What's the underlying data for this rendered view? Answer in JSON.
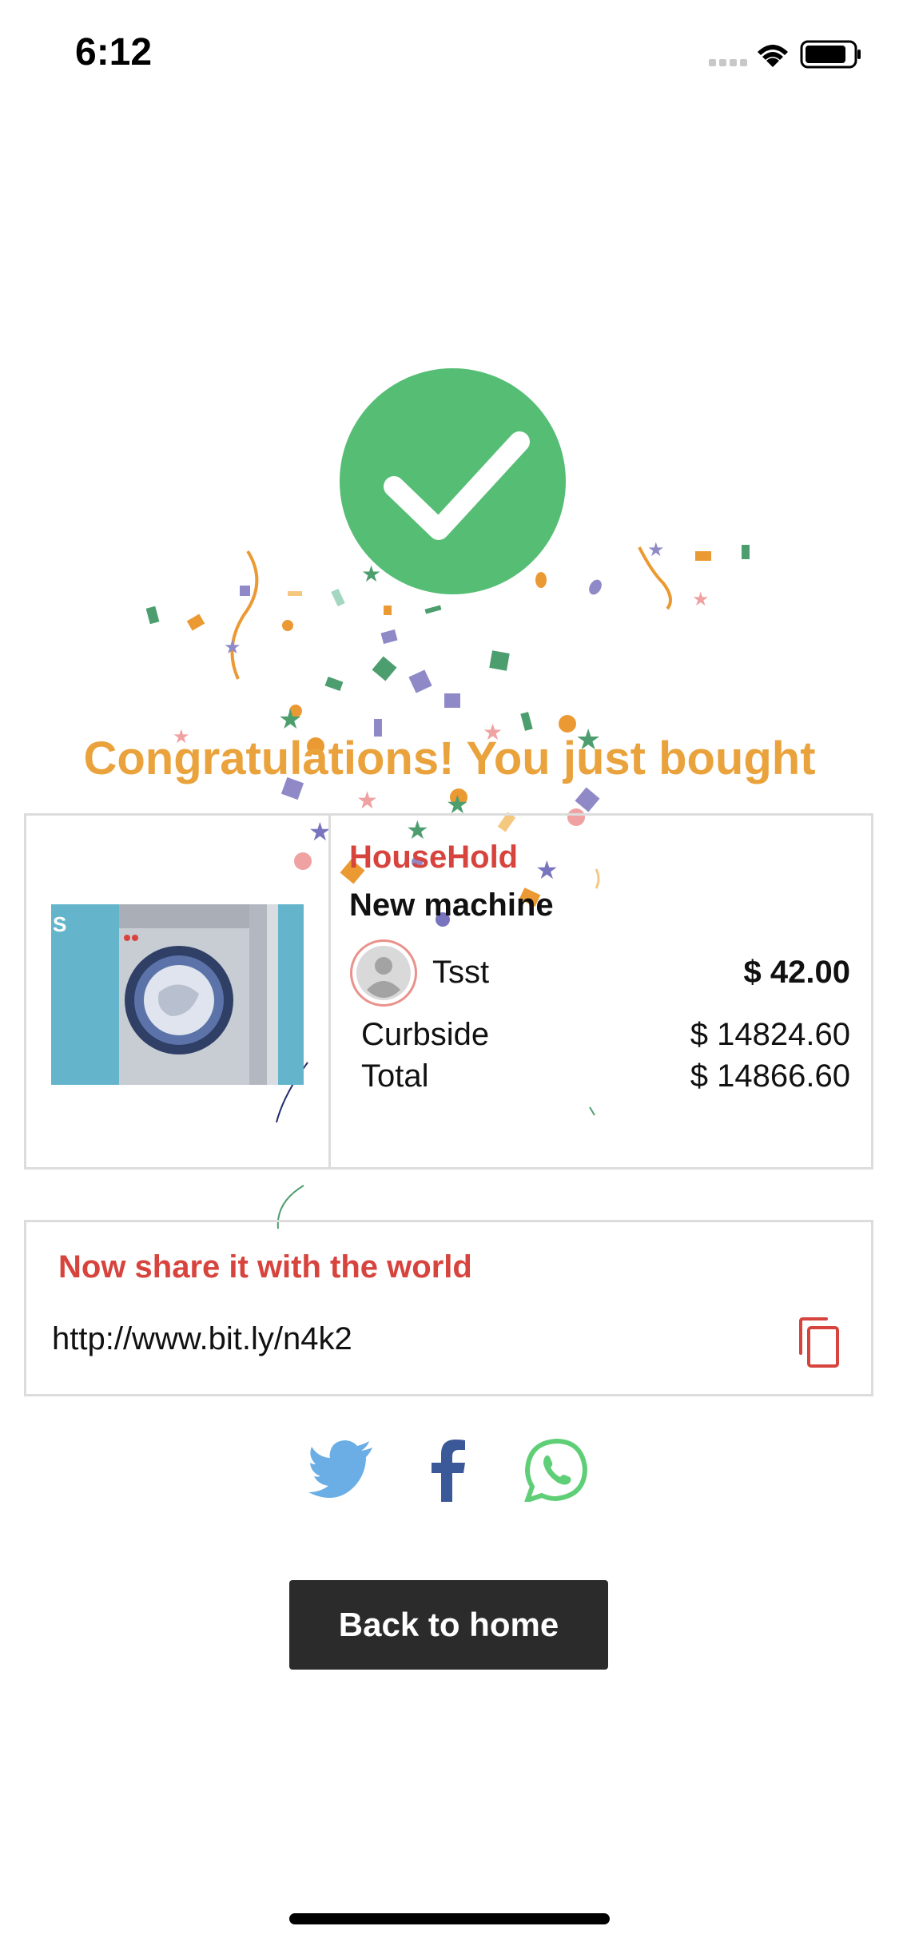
{
  "status_bar": {
    "time": "6:12",
    "icons": [
      "signal-icon",
      "wifi-icon",
      "battery-icon"
    ]
  },
  "success": {
    "icon": "checkmark-icon",
    "color": "#55bd74"
  },
  "congrats_text": "Congratulations! You just bought",
  "product": {
    "category": "HouseHold",
    "name": "New machine",
    "image_icon": "washing-machine-image",
    "seller": {
      "name": "Tsst",
      "avatar_icon": "user-avatar-icon"
    },
    "price": "$ 42.00",
    "rows": [
      {
        "label": "Curbside",
        "value": "$ 14824.60"
      },
      {
        "label": "Total",
        "value": "$ 14866.60"
      }
    ]
  },
  "share": {
    "title": "Now share it with the world",
    "link": "http://www.bit.ly/n4k2",
    "copy_icon": "copy-icon"
  },
  "social": [
    {
      "name": "twitter",
      "icon": "twitter-icon",
      "color": "#6aaee5"
    },
    {
      "name": "facebook",
      "icon": "facebook-icon",
      "color": "#3b5998"
    },
    {
      "name": "whatsapp",
      "icon": "whatsapp-icon",
      "color": "#5fcf77"
    }
  ],
  "back_button": {
    "label": "Back to home"
  },
  "colors": {
    "accent_red": "#d7433d",
    "accent_orange": "#eaa33c",
    "button_dark": "#2b2b2b",
    "border": "#dcdcdc"
  }
}
